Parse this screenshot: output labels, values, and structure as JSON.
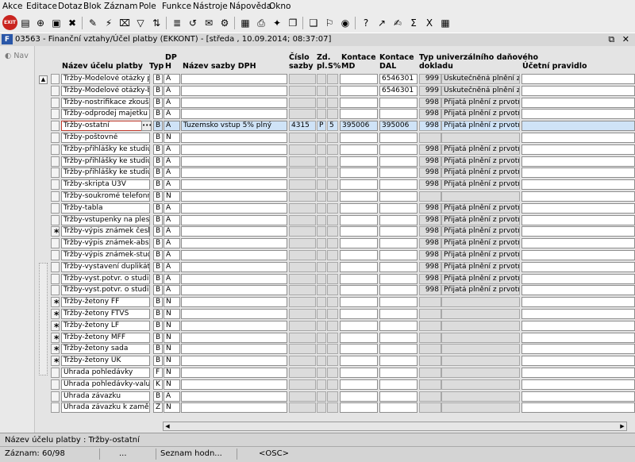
{
  "menu": [
    "Akce",
    "Editace",
    "Dotaz",
    "Blok",
    "Záznam",
    "Pole",
    "Funkce",
    "Nástroje",
    "Nápověda",
    "Okno"
  ],
  "toolbar": {
    "exit_label": "EXIT",
    "buttons": [
      {
        "icon": "save-icon",
        "glyph": "▤"
      },
      {
        "icon": "add-record-icon",
        "glyph": "⊕"
      },
      {
        "icon": "copy-record-icon",
        "glyph": "▣"
      },
      {
        "icon": "delete-record-icon",
        "glyph": "✖"
      },
      {
        "icon": "enter-query-icon",
        "glyph": "✎"
      },
      {
        "icon": "execute-query-icon",
        "glyph": "⚡"
      },
      {
        "icon": "cancel-query-icon",
        "glyph": "⌧"
      },
      {
        "icon": "filter-icon",
        "glyph": "▽"
      },
      {
        "icon": "sort-icon",
        "glyph": "⇅"
      },
      {
        "icon": "list-icon",
        "glyph": "≣"
      },
      {
        "icon": "refresh-icon",
        "glyph": "↺"
      },
      {
        "icon": "mail-icon",
        "glyph": "✉"
      },
      {
        "icon": "settings-icon",
        "glyph": "⚙"
      },
      {
        "icon": "report-icon",
        "glyph": "▦"
      },
      {
        "icon": "print-icon",
        "glyph": "⎙"
      },
      {
        "icon": "attachment-icon",
        "glyph": "✦"
      },
      {
        "icon": "doc-icon",
        "glyph": "❐"
      },
      {
        "icon": "clipboard-icon",
        "glyph": "❑"
      },
      {
        "icon": "flag-icon",
        "glyph": "⚐"
      },
      {
        "icon": "globe-icon",
        "glyph": "◉"
      },
      {
        "icon": "help-icon",
        "glyph": "?"
      },
      {
        "icon": "chart-icon",
        "glyph": "↗"
      },
      {
        "icon": "notes-icon",
        "glyph": "✍"
      },
      {
        "icon": "sum-icon",
        "glyph": "Σ"
      },
      {
        "icon": "excel-icon",
        "glyph": "X"
      },
      {
        "icon": "grid-icon",
        "glyph": "▦"
      }
    ]
  },
  "window": {
    "icon_label": "F",
    "title": "03563 - Finanční vztahy/Účel platby (EKKONT) - [středa , 10.09.2014; 08:37:07]",
    "buttons": "⧉ ✕"
  },
  "nav": {
    "label": "Nav",
    "icon": "nav-icon"
  },
  "columns": {
    "name": "Název účelu platby",
    "typ": "Typ",
    "dph": "DP\nH",
    "sazba": "Název sazby DPH",
    "cislo": "Číslo\nsazby",
    "zd": "Zd.\npl.",
    "pct": "\nS%",
    "md": "Kontace\nMD",
    "dal": "Kontace\nDAL",
    "dok": "Typ univerzálního daňového\ndokladu",
    "uct": "Účetní pravidlo"
  },
  "rows": [
    {
      "mark": "",
      "name": "Tržby-Modelové otázky pro r",
      "typ": "B",
      "dph": "A",
      "sazba": "",
      "cislo": "",
      "zd": "",
      "pct": "",
      "md": "",
      "dal": "6546301",
      "num": "999",
      "dok": "Uskutečněná plnění z p",
      "current": false
    },
    {
      "mark": "",
      "name": "Tržby-Modelové otázky-baka",
      "typ": "B",
      "dph": "A",
      "sazba": "",
      "cislo": "",
      "zd": "",
      "pct": "",
      "md": "",
      "dal": "6546301",
      "num": "999",
      "dok": "Uskutečněná plnění z p",
      "current": false
    },
    {
      "mark": "",
      "name": "Tržby-nostrifikace zkoušek v",
      "typ": "B",
      "dph": "A",
      "sazba": "",
      "cislo": "",
      "zd": "",
      "pct": "",
      "md": "",
      "dal": "",
      "num": "998",
      "dok": "Přijatá plnění z prvotních",
      "current": false
    },
    {
      "mark": "",
      "name": "Tržby-odprodej majetku",
      "typ": "B",
      "dph": "A",
      "sazba": "",
      "cislo": "",
      "zd": "",
      "pct": "",
      "md": "",
      "dal": "",
      "num": "998",
      "dok": "Přijatá plnění z prvotních",
      "current": false
    },
    {
      "mark": "",
      "name": "Tržby-ostatní",
      "typ": "B",
      "dph": "A",
      "sazba": "Tuzemsko vstup 5% plný",
      "cislo": "4315",
      "zd": "P",
      "pct": "5",
      "md": "395006",
      "dal": "395006",
      "num": "998",
      "dok": "Přijatá plnění z prvotních",
      "current": true
    },
    {
      "mark": "",
      "name": "Tržby-poštovné",
      "typ": "B",
      "dph": "N",
      "sazba": "",
      "cislo": "",
      "zd": "",
      "pct": "",
      "md": "",
      "dal": "",
      "num": "",
      "dok": "",
      "current": false
    },
    {
      "mark": "",
      "name": "Tržby-přihlášky ke studiu",
      "typ": "B",
      "dph": "A",
      "sazba": "",
      "cislo": "",
      "zd": "",
      "pct": "",
      "md": "",
      "dal": "",
      "num": "998",
      "dok": "Přijatá plnění z prvotních",
      "current": false
    },
    {
      "mark": "",
      "name": "Tržby-přihlášky ke studiu PG",
      "typ": "B",
      "dph": "A",
      "sazba": "",
      "cislo": "",
      "zd": "",
      "pct": "",
      "md": "",
      "dal": "",
      "num": "998",
      "dok": "Přijatá plnění z prvotních",
      "current": false
    },
    {
      "mark": "",
      "name": "Tržby-přihlášky ke studiu (U3",
      "typ": "B",
      "dph": "A",
      "sazba": "",
      "cislo": "",
      "zd": "",
      "pct": "",
      "md": "",
      "dal": "",
      "num": "998",
      "dok": "Přijatá plnění z prvotních",
      "current": false
    },
    {
      "mark": "",
      "name": "Tržby-skripta U3V",
      "typ": "B",
      "dph": "A",
      "sazba": "",
      "cislo": "",
      "zd": "",
      "pct": "",
      "md": "",
      "dal": "",
      "num": "998",
      "dok": "Přijatá plnění z prvotních",
      "current": false
    },
    {
      "mark": "",
      "name": "Tržby-soukromé telefonní ho",
      "typ": "B",
      "dph": "N",
      "sazba": "",
      "cislo": "",
      "zd": "",
      "pct": "",
      "md": "",
      "dal": "",
      "num": "",
      "dok": "",
      "current": false
    },
    {
      "mark": "",
      "name": "Tržby-tabla",
      "typ": "B",
      "dph": "A",
      "sazba": "",
      "cislo": "",
      "zd": "",
      "pct": "",
      "md": "",
      "dal": "",
      "num": "998",
      "dok": "Přijatá plnění z prvotních",
      "current": false
    },
    {
      "mark": "",
      "name": "Tržby-vstupenky na ples",
      "typ": "B",
      "dph": "A",
      "sazba": "",
      "cislo": "",
      "zd": "",
      "pct": "",
      "md": "",
      "dal": "",
      "num": "998",
      "dok": "Přijatá plnění z prvotních",
      "current": false
    },
    {
      "mark": "*",
      "name": "Tržby-výpis známek česky",
      "typ": "B",
      "dph": "A",
      "sazba": "",
      "cislo": "",
      "zd": "",
      "pct": "",
      "md": "",
      "dal": "",
      "num": "998",
      "dok": "Přijatá plnění z prvotních",
      "current": false
    },
    {
      "mark": "",
      "name": "Tržby-výpis známek-absolve",
      "typ": "B",
      "dph": "A",
      "sazba": "",
      "cislo": "",
      "zd": "",
      "pct": "",
      "md": "",
      "dal": "",
      "num": "998",
      "dok": "Přijatá plnění z prvotních",
      "current": false
    },
    {
      "mark": "",
      "name": "Tržby-výpis známek-student",
      "typ": "B",
      "dph": "A",
      "sazba": "",
      "cislo": "",
      "zd": "",
      "pct": "",
      "md": "",
      "dal": "",
      "num": "998",
      "dok": "Přijatá plnění z prvotních",
      "current": false
    },
    {
      "mark": "",
      "name": "Tržby-vystavení duplikátu inc",
      "typ": "B",
      "dph": "A",
      "sazba": "",
      "cislo": "",
      "zd": "",
      "pct": "",
      "md": "",
      "dal": "",
      "num": "998",
      "dok": "Přijatá plnění z prvotních",
      "current": false
    },
    {
      "mark": "",
      "name": "Tržby-vyst.potvr. o studiu-ab",
      "typ": "B",
      "dph": "A",
      "sazba": "",
      "cislo": "",
      "zd": "",
      "pct": "",
      "md": "",
      "dal": "",
      "num": "998",
      "dok": "Přijatá plnění z prvotních",
      "current": false
    },
    {
      "mark": "",
      "name": "Tržby-vyst.potvr. o studiu-st",
      "typ": "B",
      "dph": "A",
      "sazba": "",
      "cislo": "",
      "zd": "",
      "pct": "",
      "md": "",
      "dal": "",
      "num": "998",
      "dok": "Přijatá plnění z prvotních",
      "current": false
    },
    {
      "mark": "*",
      "name": "Tržby-žetony FF",
      "typ": "B",
      "dph": "N",
      "sazba": "",
      "cislo": "",
      "zd": "",
      "pct": "",
      "md": "",
      "dal": "",
      "num": "",
      "dok": "",
      "current": false
    },
    {
      "mark": "*",
      "name": "Tržby-žetony FTVS",
      "typ": "B",
      "dph": "N",
      "sazba": "",
      "cislo": "",
      "zd": "",
      "pct": "",
      "md": "",
      "dal": "",
      "num": "",
      "dok": "",
      "current": false
    },
    {
      "mark": "*",
      "name": "Tržby-žetony LF",
      "typ": "B",
      "dph": "N",
      "sazba": "",
      "cislo": "",
      "zd": "",
      "pct": "",
      "md": "",
      "dal": "",
      "num": "",
      "dok": "",
      "current": false
    },
    {
      "mark": "*",
      "name": "Tržby-žetony MFF",
      "typ": "B",
      "dph": "N",
      "sazba": "",
      "cislo": "",
      "zd": "",
      "pct": "",
      "md": "",
      "dal": "",
      "num": "",
      "dok": "",
      "current": false
    },
    {
      "mark": "*",
      "name": "Tržby-žetony sada",
      "typ": "B",
      "dph": "N",
      "sazba": "",
      "cislo": "",
      "zd": "",
      "pct": "",
      "md": "",
      "dal": "",
      "num": "",
      "dok": "",
      "current": false
    },
    {
      "mark": "*",
      "name": "Tržby-žetony UK",
      "typ": "B",
      "dph": "N",
      "sazba": "",
      "cislo": "",
      "zd": "",
      "pct": "",
      "md": "",
      "dal": "",
      "num": "",
      "dok": "",
      "current": false
    },
    {
      "mark": "",
      "name": "Úhrada pohledávky",
      "typ": "F",
      "dph": "N",
      "sazba": "",
      "cislo": "",
      "zd": "",
      "pct": "",
      "md": "",
      "dal": "",
      "num": "",
      "dok": "",
      "current": false
    },
    {
      "mark": "",
      "name": "Úhrada pohledávky-valuty",
      "typ": "K",
      "dph": "N",
      "sazba": "",
      "cislo": "",
      "zd": "",
      "pct": "",
      "md": "",
      "dal": "",
      "num": "",
      "dok": "",
      "current": false
    },
    {
      "mark": "",
      "name": "Úhrada závazku",
      "typ": "B",
      "dph": "A",
      "sazba": "",
      "cislo": "",
      "zd": "",
      "pct": "",
      "md": "",
      "dal": "",
      "num": "",
      "dok": "",
      "current": false
    },
    {
      "mark": "",
      "name": "Úhrada závazku k zaměstnan",
      "typ": "Z",
      "dph": "N",
      "sazba": "",
      "cislo": "",
      "zd": "",
      "pct": "",
      "md": "",
      "dal": "",
      "num": "",
      "dok": "",
      "current": false
    }
  ],
  "lov_button_label": "•••",
  "hint": "Název účelu platby : Tržby-ostatní",
  "status": {
    "record": "Záznam: 60/98",
    "dots": "...",
    "list": "Seznam hodn...",
    "mode": "<OSC>"
  }
}
